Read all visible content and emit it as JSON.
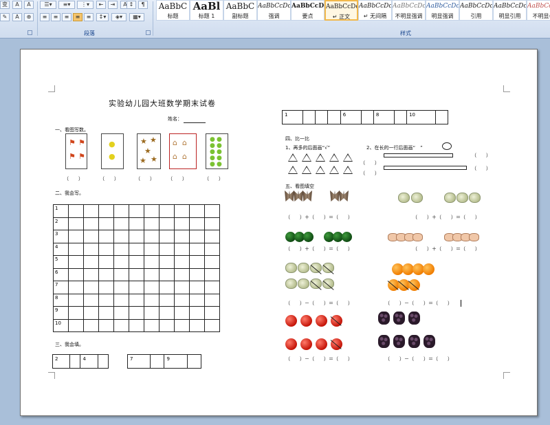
{
  "ribbon": {
    "paragraph_label": "段落",
    "styles_label": "样式",
    "left_glyphs": [
      "变",
      "A",
      "A"
    ],
    "styles": [
      {
        "sample": "AaBbC",
        "name": "标题"
      },
      {
        "sample": "AaBl",
        "name": "标题 1"
      },
      {
        "sample": "AaBbC",
        "name": "副标题"
      },
      {
        "sample": "AaBbCcDc",
        "name": "强调"
      },
      {
        "sample": "AaBbCcD",
        "name": "要点"
      },
      {
        "sample": "AaBbCcDc",
        "name": "↵ 正文"
      },
      {
        "sample": "AaBbCcDc",
        "name": "↵ 无间隔"
      },
      {
        "sample": "AaBbCcDc",
        "name": "不明显强调"
      },
      {
        "sample": "AaBbCcDc",
        "name": "明显强调"
      },
      {
        "sample": "AaBbCcDc",
        "name": "引用"
      },
      {
        "sample": "AaBbCcDc",
        "name": "明显引用"
      },
      {
        "sample": "AaBbCcDc",
        "name": "不明显参"
      }
    ]
  },
  "doc": {
    "title": "实验幼儿园大班数学期末试卷",
    "name_label": "姓名：",
    "sec1": "一、看图写数。",
    "sec2": "二、我会写。",
    "sec3": "三、我会填。",
    "sec4": "四、比一比",
    "sec4_q1": "1、再多的后面画“√”",
    "sec4_q2": "2、在长的一行后面画“　”",
    "sec5": "五、看图填空",
    "paren": "（　　）",
    "write_rows": [
      "1",
      "2",
      "3",
      "4",
      "5",
      "6",
      "7",
      "8",
      "9",
      "10"
    ],
    "fill_a": [
      "2",
      "",
      "4",
      ""
    ],
    "fill_b": [
      "7",
      "",
      "9",
      ""
    ],
    "top_strip": [
      "1",
      "",
      "",
      "",
      "6",
      "",
      "8",
      "",
      "10",
      ""
    ],
    "eq_plus": "（　　）＋（　　）＝（　　）",
    "eq_minus": "（　　）－（　　）＝（　　）"
  }
}
